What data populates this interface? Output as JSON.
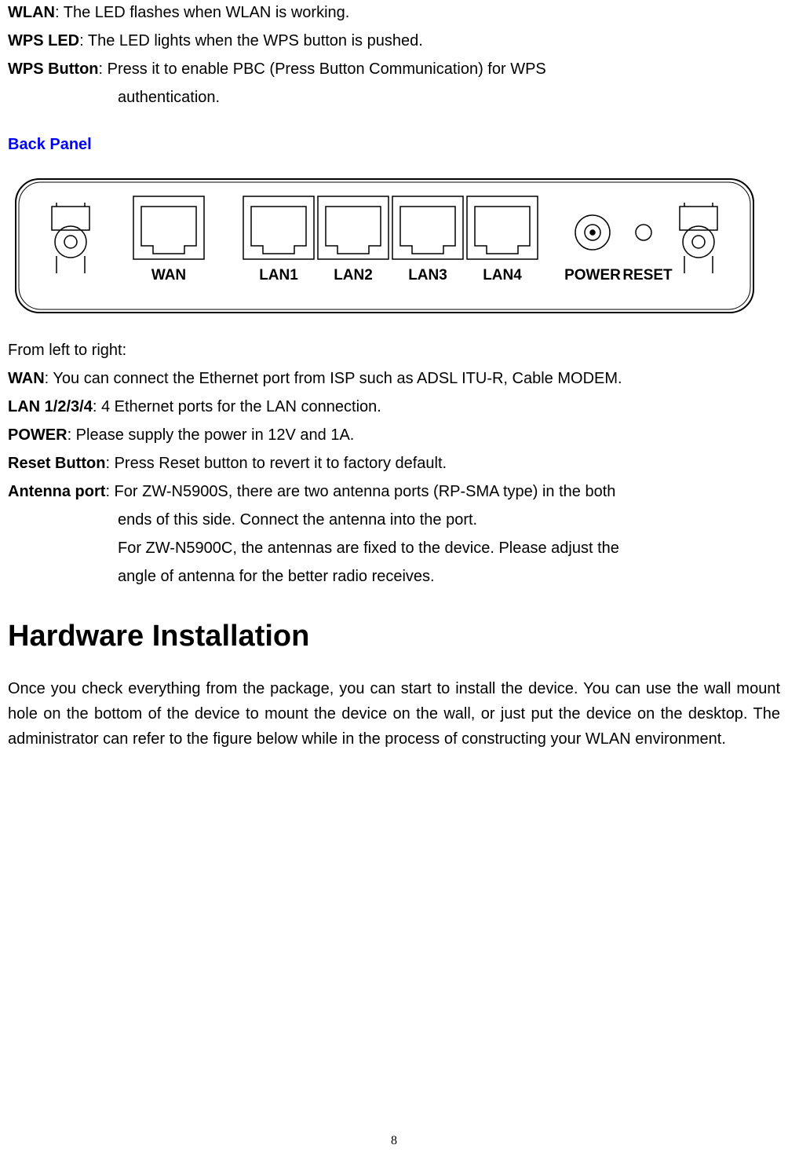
{
  "definitions": {
    "wlan_term": "WLAN",
    "wlan_desc": ": The LED flashes when WLAN is working.",
    "wps_led_term": "WPS LED",
    "wps_led_desc": ": The LED lights when the WPS button is pushed.",
    "wps_button_term": "WPS Button",
    "wps_button_desc": ": Press it to enable PBC (Press Button Communication) for WPS",
    "wps_button_cont": "authentication."
  },
  "back_panel_heading": "Back Panel",
  "panel_labels": {
    "wan": "WAN",
    "lan1": "LAN1",
    "lan2": "LAN2",
    "lan3": "LAN3",
    "lan4": "LAN4",
    "power": "POWER",
    "reset": "RESET"
  },
  "from_left": "From left to right:",
  "back_defs": {
    "wan_term": "WAN",
    "wan_desc": ": You can connect the Ethernet port from ISP such as ADSL ITU-R, Cable MODEM.",
    "lan_term": "LAN 1/2/3/4",
    "lan_desc": ": 4 Ethernet ports for the LAN connection.",
    "power_term": "POWER",
    "power_desc": ": Please supply the power in 12V and 1A.",
    "reset_term": "Reset Button",
    "reset_desc": ": Press Reset button to revert it to factory default.",
    "antenna_term": "Antenna port",
    "antenna_desc": ": For ZW-N5900S, there are two antenna ports (RP-SMA type) in the both",
    "antenna_cont1": "ends of this side. Connect the antenna into the port.",
    "antenna_cont2": "For ZW-N5900C, the antennas are fixed to the device. Please adjust the",
    "antenna_cont3": "angle of antenna for the better radio receives."
  },
  "hardware_heading": "Hardware Installation",
  "hardware_paragraph": "Once you check everything from the package, you can start to install the device. You can use the wall mount hole on the bottom of the device to mount the device on the wall, or just put the device on the desktop. The administrator can refer to the figure below while in the process of constructing your WLAN environment.",
  "page_number": "8"
}
